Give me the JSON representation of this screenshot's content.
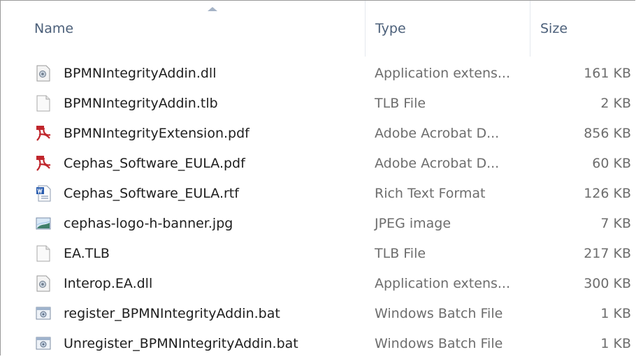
{
  "columns": {
    "name": "Name",
    "type": "Type",
    "size": "Size"
  },
  "files": [
    {
      "name": "BPMNIntegrityAddin.dll",
      "type": "Application extens...",
      "size": "161 KB",
      "icon": "dll-icon"
    },
    {
      "name": "BPMNIntegrityAddin.tlb",
      "type": "TLB File",
      "size": "2 KB",
      "icon": "blank-file-icon"
    },
    {
      "name": "BPMNIntegrityExtension.pdf",
      "type": "Adobe Acrobat D...",
      "size": "856 KB",
      "icon": "pdf-icon"
    },
    {
      "name": "Cephas_Software_EULA.pdf",
      "type": "Adobe Acrobat D...",
      "size": "60 KB",
      "icon": "pdf-icon"
    },
    {
      "name": "Cephas_Software_EULA.rtf",
      "type": "Rich Text Format",
      "size": "126 KB",
      "icon": "rtf-icon"
    },
    {
      "name": "cephas-logo-h-banner.jpg",
      "type": "JPEG image",
      "size": "7 KB",
      "icon": "image-icon"
    },
    {
      "name": "EA.TLB",
      "type": "TLB File",
      "size": "217 KB",
      "icon": "blank-file-icon"
    },
    {
      "name": "Interop.EA.dll",
      "type": "Application extens...",
      "size": "300 KB",
      "icon": "dll-icon"
    },
    {
      "name": "register_BPMNIntegrityAddin.bat",
      "type": "Windows Batch File",
      "size": "1 KB",
      "icon": "batch-icon"
    },
    {
      "name": "Unregister_BPMNIntegrityAddin.bat",
      "type": "Windows Batch File",
      "size": "1 KB",
      "icon": "batch-icon"
    }
  ]
}
